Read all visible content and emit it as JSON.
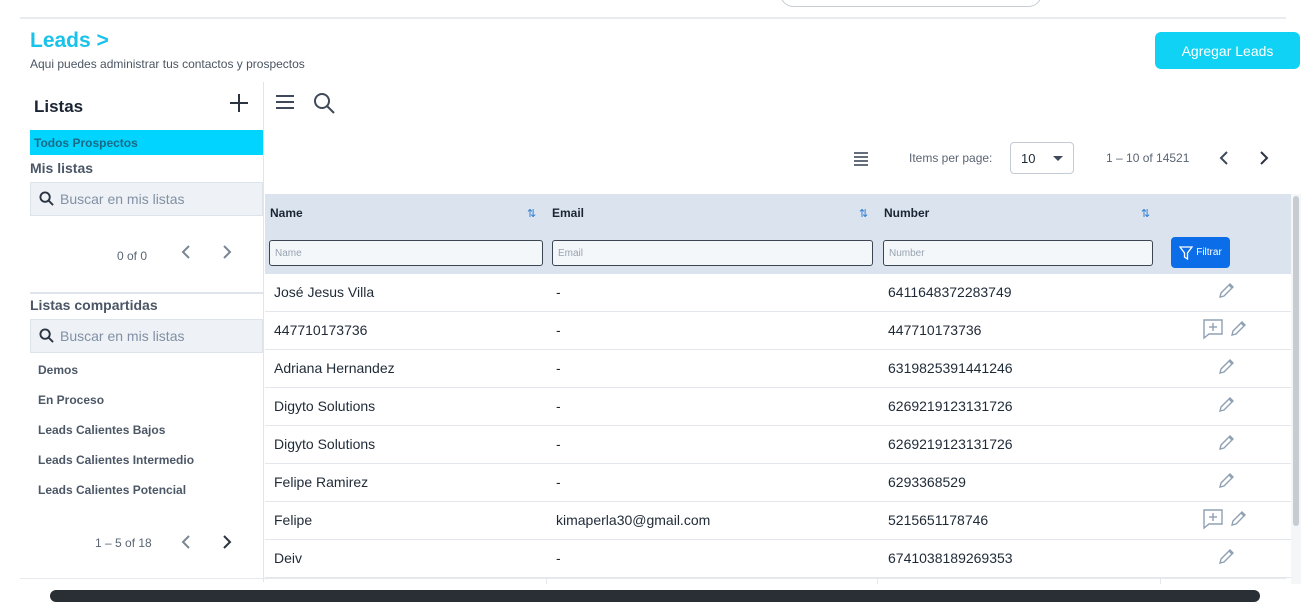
{
  "header": {
    "title": "Leads >",
    "subtitle": "Aqui puedes administrar tus contactos y prospectos",
    "add_button": "Agregar Leads"
  },
  "sidebar": {
    "heading": "Listas",
    "all_prospects": "Todos Prospectos",
    "my_lists_label": "Mis listas",
    "my_lists_search_placeholder": "Buscar en mis listas",
    "my_lists_range": "0 of 0",
    "shared_label": "Listas compartidas",
    "shared_search_placeholder": "Buscar en mis listas",
    "shared_items": [
      "Demos",
      "En Proceso",
      "Leads Calientes Bajos",
      "Leads Calientes Intermedio",
      "Leads Calientes Potencial"
    ],
    "shared_range": "1 – 5 of 18"
  },
  "paginator": {
    "items_per_page_label": "Items per page:",
    "items_per_page_value": "10",
    "range": "1 – 10 of 14521"
  },
  "table": {
    "columns": [
      "Name",
      "Email",
      "Number"
    ],
    "filter_placeholders": [
      "Name",
      "Email",
      "Number"
    ],
    "filter_button": "Filtrar",
    "rows": [
      {
        "name": "José Jesus Villa",
        "email": "-",
        "number": "6411648372283749",
        "add_note": false
      },
      {
        "name": "447710173736",
        "email": "-",
        "number": "447710173736",
        "add_note": true
      },
      {
        "name": "Adriana Hernandez",
        "email": "-",
        "number": "6319825391441246",
        "add_note": false
      },
      {
        "name": "Digyto Solutions",
        "email": "-",
        "number": "6269219123131726",
        "add_note": false
      },
      {
        "name": "Digyto Solutions",
        "email": "-",
        "number": "6269219123131726",
        "add_note": false
      },
      {
        "name": "Felipe Ramirez",
        "email": "-",
        "number": "6293368529",
        "add_note": false
      },
      {
        "name": "Felipe",
        "email": "kimaperla30@gmail.com",
        "number": "5215651178746",
        "add_note": true
      },
      {
        "name": "Deiv",
        "email": "-",
        "number": "6741038189269353",
        "add_note": false
      }
    ]
  },
  "colors": {
    "accent": "#00d4ff",
    "primary_button": "#0b6ee8",
    "title": "#19c2ea",
    "header_bg": "#dbe4ee"
  },
  "icons": [
    "menu-icon",
    "search-icon",
    "plus-icon",
    "chevron-left-icon",
    "chevron-right-icon",
    "list-icon",
    "filter-icon",
    "edit-icon",
    "add-comment-icon"
  ]
}
